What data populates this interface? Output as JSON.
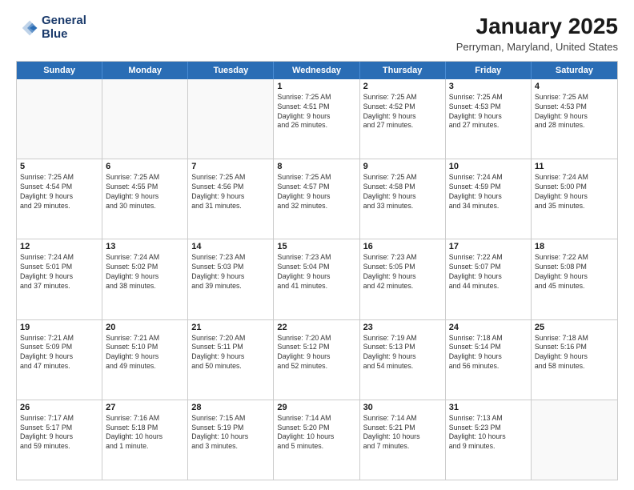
{
  "logo": {
    "line1": "General",
    "line2": "Blue"
  },
  "title": "January 2025",
  "subtitle": "Perryman, Maryland, United States",
  "headers": [
    "Sunday",
    "Monday",
    "Tuesday",
    "Wednesday",
    "Thursday",
    "Friday",
    "Saturday"
  ],
  "weeks": [
    [
      {
        "day": "",
        "info": ""
      },
      {
        "day": "",
        "info": ""
      },
      {
        "day": "",
        "info": ""
      },
      {
        "day": "1",
        "info": "Sunrise: 7:25 AM\nSunset: 4:51 PM\nDaylight: 9 hours\nand 26 minutes."
      },
      {
        "day": "2",
        "info": "Sunrise: 7:25 AM\nSunset: 4:52 PM\nDaylight: 9 hours\nand 27 minutes."
      },
      {
        "day": "3",
        "info": "Sunrise: 7:25 AM\nSunset: 4:53 PM\nDaylight: 9 hours\nand 27 minutes."
      },
      {
        "day": "4",
        "info": "Sunrise: 7:25 AM\nSunset: 4:53 PM\nDaylight: 9 hours\nand 28 minutes."
      }
    ],
    [
      {
        "day": "5",
        "info": "Sunrise: 7:25 AM\nSunset: 4:54 PM\nDaylight: 9 hours\nand 29 minutes."
      },
      {
        "day": "6",
        "info": "Sunrise: 7:25 AM\nSunset: 4:55 PM\nDaylight: 9 hours\nand 30 minutes."
      },
      {
        "day": "7",
        "info": "Sunrise: 7:25 AM\nSunset: 4:56 PM\nDaylight: 9 hours\nand 31 minutes."
      },
      {
        "day": "8",
        "info": "Sunrise: 7:25 AM\nSunset: 4:57 PM\nDaylight: 9 hours\nand 32 minutes."
      },
      {
        "day": "9",
        "info": "Sunrise: 7:25 AM\nSunset: 4:58 PM\nDaylight: 9 hours\nand 33 minutes."
      },
      {
        "day": "10",
        "info": "Sunrise: 7:24 AM\nSunset: 4:59 PM\nDaylight: 9 hours\nand 34 minutes."
      },
      {
        "day": "11",
        "info": "Sunrise: 7:24 AM\nSunset: 5:00 PM\nDaylight: 9 hours\nand 35 minutes."
      }
    ],
    [
      {
        "day": "12",
        "info": "Sunrise: 7:24 AM\nSunset: 5:01 PM\nDaylight: 9 hours\nand 37 minutes."
      },
      {
        "day": "13",
        "info": "Sunrise: 7:24 AM\nSunset: 5:02 PM\nDaylight: 9 hours\nand 38 minutes."
      },
      {
        "day": "14",
        "info": "Sunrise: 7:23 AM\nSunset: 5:03 PM\nDaylight: 9 hours\nand 39 minutes."
      },
      {
        "day": "15",
        "info": "Sunrise: 7:23 AM\nSunset: 5:04 PM\nDaylight: 9 hours\nand 41 minutes."
      },
      {
        "day": "16",
        "info": "Sunrise: 7:23 AM\nSunset: 5:05 PM\nDaylight: 9 hours\nand 42 minutes."
      },
      {
        "day": "17",
        "info": "Sunrise: 7:22 AM\nSunset: 5:07 PM\nDaylight: 9 hours\nand 44 minutes."
      },
      {
        "day": "18",
        "info": "Sunrise: 7:22 AM\nSunset: 5:08 PM\nDaylight: 9 hours\nand 45 minutes."
      }
    ],
    [
      {
        "day": "19",
        "info": "Sunrise: 7:21 AM\nSunset: 5:09 PM\nDaylight: 9 hours\nand 47 minutes."
      },
      {
        "day": "20",
        "info": "Sunrise: 7:21 AM\nSunset: 5:10 PM\nDaylight: 9 hours\nand 49 minutes."
      },
      {
        "day": "21",
        "info": "Sunrise: 7:20 AM\nSunset: 5:11 PM\nDaylight: 9 hours\nand 50 minutes."
      },
      {
        "day": "22",
        "info": "Sunrise: 7:20 AM\nSunset: 5:12 PM\nDaylight: 9 hours\nand 52 minutes."
      },
      {
        "day": "23",
        "info": "Sunrise: 7:19 AM\nSunset: 5:13 PM\nDaylight: 9 hours\nand 54 minutes."
      },
      {
        "day": "24",
        "info": "Sunrise: 7:18 AM\nSunset: 5:14 PM\nDaylight: 9 hours\nand 56 minutes."
      },
      {
        "day": "25",
        "info": "Sunrise: 7:18 AM\nSunset: 5:16 PM\nDaylight: 9 hours\nand 58 minutes."
      }
    ],
    [
      {
        "day": "26",
        "info": "Sunrise: 7:17 AM\nSunset: 5:17 PM\nDaylight: 9 hours\nand 59 minutes."
      },
      {
        "day": "27",
        "info": "Sunrise: 7:16 AM\nSunset: 5:18 PM\nDaylight: 10 hours\nand 1 minute."
      },
      {
        "day": "28",
        "info": "Sunrise: 7:15 AM\nSunset: 5:19 PM\nDaylight: 10 hours\nand 3 minutes."
      },
      {
        "day": "29",
        "info": "Sunrise: 7:14 AM\nSunset: 5:20 PM\nDaylight: 10 hours\nand 5 minutes."
      },
      {
        "day": "30",
        "info": "Sunrise: 7:14 AM\nSunset: 5:21 PM\nDaylight: 10 hours\nand 7 minutes."
      },
      {
        "day": "31",
        "info": "Sunrise: 7:13 AM\nSunset: 5:23 PM\nDaylight: 10 hours\nand 9 minutes."
      },
      {
        "day": "",
        "info": ""
      }
    ]
  ]
}
